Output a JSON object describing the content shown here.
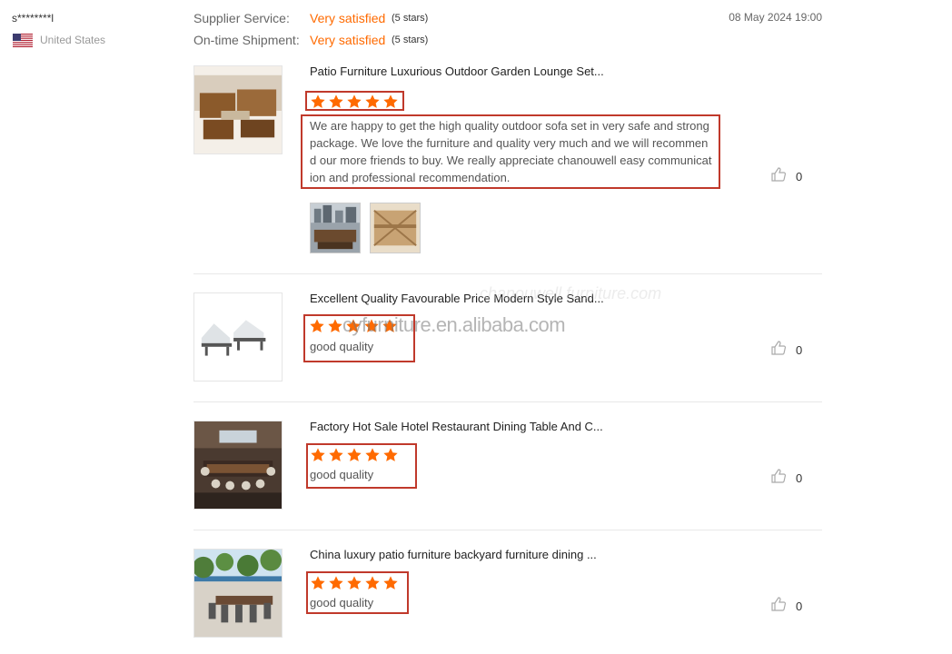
{
  "reviewer": {
    "name": "s********l",
    "country": "United States",
    "flag_icon": "us-flag-icon"
  },
  "ratings": {
    "supplier_service": {
      "label": "Supplier Service:",
      "value": "Very satisfied",
      "stars_text": "(5 stars)"
    },
    "ontime_shipment": {
      "label": "On-time Shipment:",
      "value": "Very satisfied",
      "stars_text": "(5 stars)"
    }
  },
  "date": "08 May 2024 19:00",
  "watermarks": {
    "primary": "chanouwell furniture.com",
    "overlay": "cyfurniture.en.alibaba.com"
  },
  "colors": {
    "accent_orange": "#ff6a00",
    "highlight_red": "#c0392b",
    "muted_text": "#999999"
  },
  "reviews": [
    {
      "title": "Patio Furniture Luxurious Outdoor Garden Lounge Set...",
      "stars": 5,
      "text": "We are happy to get the high quality outdoor sofa set in very safe and strong package. We love the furniture and quality very much and we will recommend our more friends to buy. We really appreciate chanouwell easy communication and professional recommendation.",
      "likes": "0",
      "photos": [
        "photo-1",
        "photo-2"
      ]
    },
    {
      "title": "Excellent Quality Favourable Price Modern Style Sand...",
      "stars": 5,
      "text": "good quality",
      "likes": "0"
    },
    {
      "title": "Factory Hot Sale Hotel Restaurant Dining Table And C...",
      "stars": 5,
      "text": "good quality",
      "likes": "0"
    },
    {
      "title": "China luxury patio furniture backyard furniture dining ...",
      "stars": 5,
      "text": "good quality",
      "likes": "0"
    }
  ]
}
